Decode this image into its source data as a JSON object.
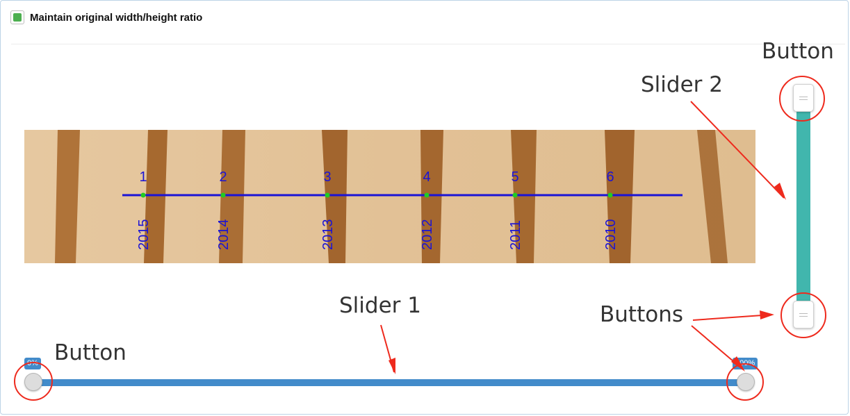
{
  "options": {
    "maintain_ratio_label": "Maintain original width/height ratio",
    "maintain_ratio_checked": true,
    "check_color": "#4caf50"
  },
  "core_image": {
    "points": [
      {
        "number": "1",
        "year": "2015"
      },
      {
        "number": "2",
        "year": "2014"
      },
      {
        "number": "3",
        "year": "2013"
      },
      {
        "number": "4",
        "year": "2012"
      },
      {
        "number": "5",
        "year": "2011"
      },
      {
        "number": "6",
        "year": "2010"
      }
    ],
    "line_color": "#1a13d6",
    "point_color": "#22cc22"
  },
  "slider_1": {
    "min_label": "0%",
    "max_label": "100%",
    "color": "#428bca"
  },
  "slider_2": {
    "color": "#41b6ad"
  },
  "annotations": {
    "button_top": "Button",
    "slider_2": "Slider 2",
    "slider_1": "Slider 1",
    "buttons": "Buttons",
    "button_left": "Button",
    "color": "#ee2a1d"
  }
}
